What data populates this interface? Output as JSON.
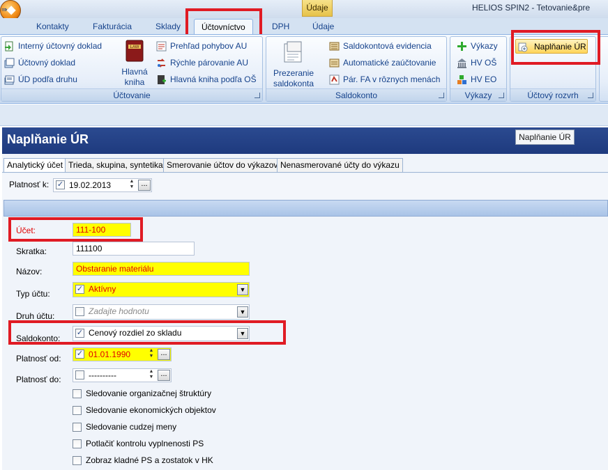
{
  "window": {
    "app_title": "HELIOS SPIN2 - Tetovanie&pre",
    "context_tab": "Údaje"
  },
  "ribbon_tabs": [
    "Kontakty",
    "Fakturácia",
    "Sklady",
    "Účtovníctvo",
    "DPH",
    "Údaje"
  ],
  "ribbon": {
    "uctovanie": {
      "label": "Účtovanie",
      "buttons": [
        "Interný účtovný doklad",
        "Účtovný doklad",
        "ÚD podľa druhu"
      ],
      "big_button": [
        "Hlavná",
        "kniha"
      ],
      "big_icon_text": "LAW",
      "buttons2": [
        "Prehľad pohybov AU",
        "Rýchle párovanie AU",
        "Hlavná kniha podľa OŠ"
      ]
    },
    "saldokonto": {
      "label": "Saldokonto",
      "big_button": [
        "Prezeranie",
        "saldokonta"
      ],
      "buttons": [
        "Saldokontová evidencia",
        "Automatické zaúčtovanie",
        "Pár. FA v rôznych menách"
      ]
    },
    "vykazy": {
      "label": "Výkazy",
      "buttons": [
        "Výkazy",
        "HV OŠ",
        "HV EO"
      ]
    },
    "uctovy_rozvrh": {
      "label": "Účtový rozvrh",
      "buttons": [
        "Naplňanie ÚR"
      ]
    }
  },
  "form": {
    "title": "Naplňanie ÚR",
    "tooltip": "Naplňanie ÚR",
    "tabs": [
      "Analytický účet",
      "Trieda, skupina, syntetika",
      "Smerovanie účtov do výkazov",
      "Nenasmerované účty do výkazu"
    ],
    "validity": {
      "label": "Platnosť k:",
      "value": "19.02.2013",
      "checked": true
    },
    "fields": {
      "ucet": {
        "label": "Účet:",
        "value": "111-100"
      },
      "skratka": {
        "label": "Skratka:",
        "value": "111100"
      },
      "nazov": {
        "label": "Názov:",
        "value": "Obstaranie materiálu"
      },
      "typ_uctu": {
        "label": "Typ účtu:",
        "value": "Aktívny",
        "checked": true
      },
      "druh_uctu": {
        "label": "Druh účtu:",
        "placeholder": "Zadajte hodnotu",
        "checked": false
      },
      "saldokonto": {
        "label": "Saldokonto:",
        "value": "Cenový rozdiel zo skladu",
        "checked": true
      },
      "platnost_od": {
        "label": "Platnosť od:",
        "value": "01.01.1990",
        "checked": true
      },
      "platnost_do": {
        "label": "Platnosť do:",
        "value": "----------",
        "checked": false
      }
    },
    "checkboxes": [
      "Sledovanie organizačnej štruktúry",
      "Sledovanie ekonomických objektov",
      "Sledovanie cudzej meny",
      "Potlačiť kontrolu vyplnenosti PS",
      "Zobraz kladné PS a zostatok v HK"
    ]
  },
  "colors": {
    "highlight_red": "#e01b24",
    "required_yellow": "#ffff00",
    "form_header_blue": "#1e3a7e",
    "ribbon_text": "#15428b"
  }
}
